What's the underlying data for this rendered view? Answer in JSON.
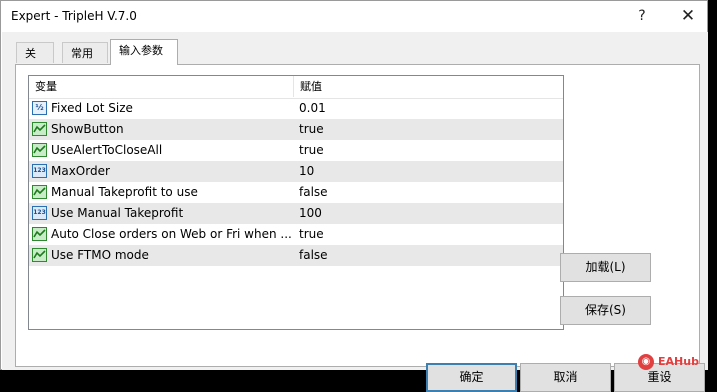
{
  "window": {
    "title": "Expert - TripleH V.7.0",
    "help_glyph": "?",
    "close_glyph": "✕"
  },
  "tabs": [
    {
      "label": "关于"
    },
    {
      "label": "常用"
    },
    {
      "label": "输入参数"
    }
  ],
  "grid": {
    "headers": {
      "variable": "变量",
      "value": "赋值"
    },
    "rows": [
      {
        "icon": "double-param-icon",
        "icon_text": "½",
        "variable": "Fixed Lot Size",
        "value": "0.01"
      },
      {
        "icon": "bool-param-icon",
        "variable": "ShowButton",
        "value": "true"
      },
      {
        "icon": "bool-param-icon",
        "variable": "UseAlertToCloseAll",
        "value": "true"
      },
      {
        "icon": "int-param-icon",
        "icon_text": "123",
        "variable": "MaxOrder",
        "value": "10"
      },
      {
        "icon": "bool-param-icon",
        "variable": "Manual Takeprofit to use",
        "value": "false"
      },
      {
        "icon": "int-param-icon",
        "icon_text": "123",
        "variable": "Use Manual Takeprofit",
        "value": "100"
      },
      {
        "icon": "bool-param-icon",
        "variable": "Auto Close orders on Web or Fri when ...",
        "value": "true"
      },
      {
        "icon": "bool-param-icon",
        "variable": "Use FTMO mode",
        "value": "false"
      }
    ]
  },
  "buttons": {
    "load": "加载(L)",
    "save": "保存(S)",
    "ok": "确定",
    "cancel": "取消",
    "reset": "重设"
  },
  "watermark": {
    "text": "EAHub"
  }
}
